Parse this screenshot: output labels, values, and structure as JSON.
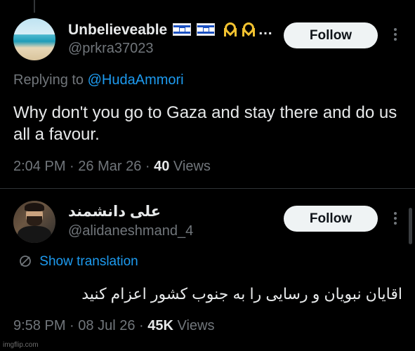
{
  "post1": {
    "display_name": "Unbelieveable",
    "name_suffix": "…",
    "handle": "@prkra37023",
    "follow_label": "Follow",
    "replying_prefix": "Replying to",
    "replying_to": "@HudaAmmori",
    "text": "Why don't you go to Gaza and stay there and do us all a favour.",
    "time": "2:04 PM",
    "date": "26 Mar 26",
    "views_count": "40",
    "views_label": "Views",
    "icons": [
      "israel-flag-icon",
      "yellow-ribbon-icon",
      "more-icon"
    ]
  },
  "post2": {
    "display_name": "علی دانشمند",
    "handle": "@alidaneshmand_4",
    "follow_label": "Follow",
    "translate_label": "Show translation",
    "text": "اقایان نبویان و رسایی را به جنوب کشور اعزام کنید",
    "time": "9:58 PM",
    "date": "08 Jul 26",
    "views_count": "45K",
    "views_label": "Views",
    "icons": [
      "globe-icon",
      "more-icon"
    ]
  },
  "watermark": "imgflip.com",
  "colors": {
    "background": "#000000",
    "text_primary": "#e7e9ea",
    "text_secondary": "#71767b",
    "accent": "#1d9bf0",
    "button_bg": "#eff3f4",
    "ribbon": "#f2c230",
    "flag_blue": "#1a4fc0"
  }
}
